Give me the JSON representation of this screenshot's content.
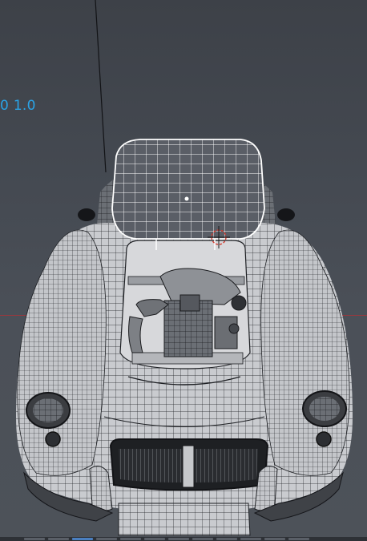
{
  "viewport": {
    "overlay_value": "0 1.0",
    "object_name": "car-wireframe-model",
    "colors": {
      "background_top": "#3d4148",
      "background_bottom": "#4d5259",
      "overlay_text": "#2aa3e6",
      "x_axis": "#a3343a",
      "mesh_fill": "#c9cbcf",
      "mesh_wire": "#1e2024",
      "selected_wire": "#ffffff",
      "cursor": "#d33a2e"
    }
  },
  "statusbar": {
    "active_index": 2
  }
}
